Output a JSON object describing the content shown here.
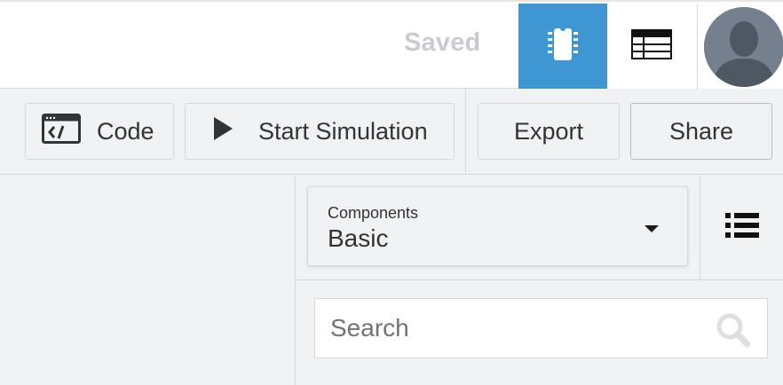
{
  "header": {
    "save_status": "Saved"
  },
  "toolbar": {
    "code_label": "Code",
    "simulate_label": "Start Simulation",
    "export_label": "Export",
    "share_label": "Share"
  },
  "components": {
    "label": "Components",
    "selected": "Basic"
  },
  "search": {
    "placeholder": "Search"
  },
  "colors": {
    "accent": "#3e96d2",
    "saved_text": "#c8ccd2",
    "panel_bg": "#f1f2f4"
  },
  "icons": {
    "circuit_view": "circuit-view-icon",
    "schematic_view": "schematic-view-icon",
    "code": "code-icon",
    "play": "play-icon",
    "list": "list-icon",
    "search": "search-icon",
    "avatar": "avatar"
  }
}
